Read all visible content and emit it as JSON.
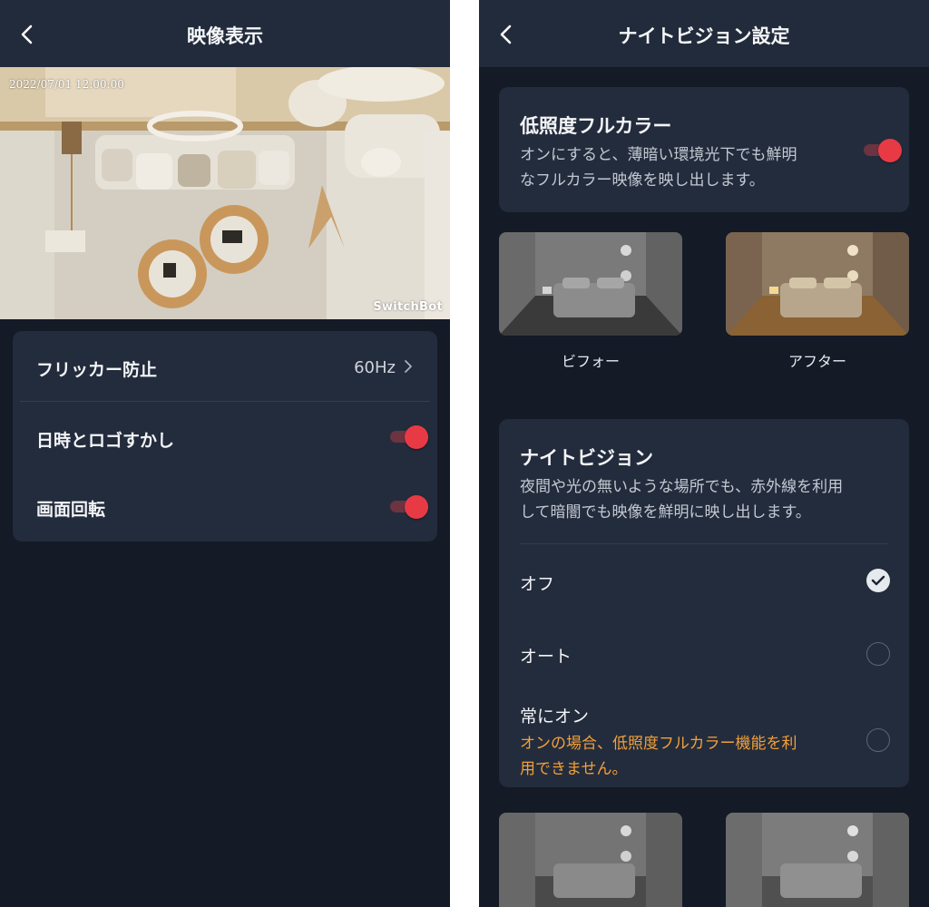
{
  "left": {
    "header": {
      "title": "映像表示"
    },
    "preview": {
      "timestamp": "2022/07/01 12:00:00",
      "logo": "SwitchBot"
    },
    "settings": {
      "flicker": {
        "label": "フリッカー防止",
        "value": "60Hz"
      },
      "watermark": {
        "label": "日時とロゴすかし",
        "enabled": true
      },
      "rotate": {
        "label": "画面回転",
        "enabled": true
      }
    }
  },
  "right": {
    "header": {
      "title": "ナイトビジョン設定"
    },
    "lowlight": {
      "title": "低照度フルカラー",
      "desc_line1": "オンにすると、薄暗い環境光下でも鮮明",
      "desc_line2": "なフルカラー映像を映し出します。",
      "enabled": true
    },
    "compare": {
      "before_label": "ビフォー",
      "after_label": "アフター"
    },
    "nightvision": {
      "title": "ナイトビジョン",
      "desc_line1": "夜間や光の無いような場所でも、赤外線を利用",
      "desc_line2": "して暗闇でも映像を鮮明に映し出します。",
      "options": [
        {
          "label": "オフ",
          "selected": true
        },
        {
          "label": "オート",
          "selected": false
        },
        {
          "label": "常にオン",
          "selected": false
        }
      ],
      "warning_line1": "オンの場合、低照度フルカラー機能を利",
      "warning_line2": "用できません。"
    }
  },
  "colors": {
    "background": "#141a26",
    "card": "#232c3c",
    "navbar": "#222b3b",
    "toggle_on": "#e83a45",
    "warning": "#f2a03a"
  },
  "icons": [
    "chevron-left-icon",
    "chevron-right-icon",
    "check-icon"
  ]
}
